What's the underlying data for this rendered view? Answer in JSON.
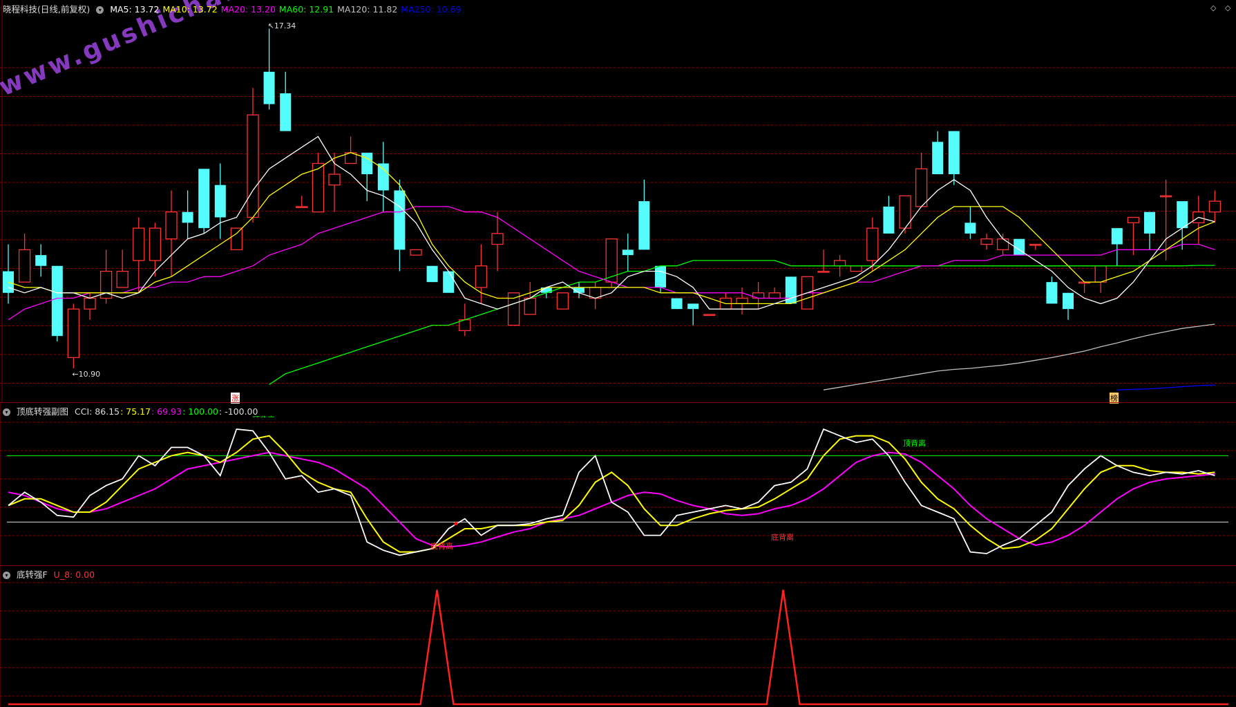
{
  "main": {
    "title": "晓程科技(日线,前复权)",
    "ma": [
      {
        "label": "MA5: 13.72",
        "color": "#ffffff"
      },
      {
        "label": "MA10: 13.72",
        "color": "#ffff00"
      },
      {
        "label": "MA20: 13.20",
        "color": "#ff00ff"
      },
      {
        "label": "MA60: 12.91",
        "color": "#00ff00"
      },
      {
        "label": "MA120: 11.82",
        "color": "#c0c0c0"
      },
      {
        "label": "MA250: 10.69",
        "color": "#0000ff"
      }
    ],
    "high_label": "17.34",
    "low_label": "10.90",
    "watermark": "www.gushichanghong.com",
    "badge_zhang": "涨",
    "badge_bang": "榜",
    "icon_left": "diamond-icon",
    "icon_right": "diamond-icon"
  },
  "sub": {
    "title": "顶底转强副图",
    "cci_label": "CCI: 86.15",
    "v1": ": 75.17",
    "v2": ": 69.93",
    "v3": ": 100.00",
    "v4": ": -100.00",
    "top_div_1": "顶背离",
    "top_div_2": "顶背离",
    "bottom_div_1": "底背离",
    "bottom_div_2": "底背离",
    "star": "★"
  },
  "bottom": {
    "title": "底转强F",
    "u8_label": "U_8: 0.00"
  },
  "colors": {
    "up": "#ff3232",
    "down": "#54fcfc",
    "grid": "#8b0000",
    "ma5": "#ffffff",
    "ma10": "#ffff00",
    "ma20": "#ff00ff",
    "ma60": "#00ff00",
    "ma120": "#c0c0c0",
    "ma250": "#0000ff"
  },
  "chart_data": [
    {
      "type": "candlestick",
      "y_range": [
        10.5,
        17.6
      ],
      "candles": [
        [
          12.8,
          12.4,
          13.3,
          12.2
        ],
        [
          12.6,
          13.2,
          13.5,
          12.6
        ],
        [
          13.1,
          12.9,
          13.3,
          12.7
        ],
        [
          12.9,
          11.6,
          12.9,
          11.5
        ],
        [
          11.2,
          12.1,
          12.2,
          11.0
        ],
        [
          12.1,
          12.3,
          12.4,
          11.9
        ],
        [
          12.3,
          12.8,
          13.2,
          12.2
        ],
        [
          12.5,
          12.8,
          13.2,
          12.7
        ],
        [
          13.0,
          13.6,
          13.8,
          12.4
        ],
        [
          13.0,
          13.6,
          13.7,
          12.7
        ],
        [
          13.4,
          13.9,
          14.3,
          12.7
        ],
        [
          13.9,
          13.7,
          14.3,
          13.4
        ],
        [
          14.7,
          13.6,
          14.6,
          13.5
        ],
        [
          14.4,
          13.8,
          14.8,
          13.4
        ],
        [
          13.2,
          13.6,
          13.6,
          13.2
        ],
        [
          13.8,
          15.7,
          16.2,
          13.7
        ],
        [
          16.5,
          15.9,
          17.3,
          15.8
        ],
        [
          16.1,
          15.4,
          16.5,
          15.4
        ],
        [
          14.0,
          14.0,
          14.2,
          14.0
        ],
        [
          13.9,
          14.8,
          15.0,
          13.9
        ],
        [
          14.4,
          14.6,
          15.0,
          13.9
        ],
        [
          14.8,
          15.0,
          15.3,
          14.8
        ],
        [
          15.0,
          14.6,
          14.9,
          14.1
        ],
        [
          14.8,
          14.3,
          15.2,
          13.9
        ],
        [
          14.3,
          13.2,
          14.5,
          12.8
        ],
        [
          13.1,
          13.2,
          13.2,
          13.1
        ],
        [
          12.9,
          12.6,
          12.9,
          12.6
        ],
        [
          12.8,
          12.4,
          12.8,
          12.5
        ],
        [
          11.7,
          11.9,
          12.2,
          11.6
        ],
        [
          12.5,
          12.9,
          13.3,
          12.2
        ],
        [
          13.3,
          13.5,
          13.9,
          12.8
        ],
        [
          11.8,
          12.4,
          12.4,
          11.8
        ],
        [
          12.0,
          12.3,
          12.6,
          12.0
        ],
        [
          12.5,
          12.4,
          12.5,
          12.3
        ],
        [
          12.1,
          12.4,
          12.4,
          12.1
        ],
        [
          12.5,
          12.4,
          12.6,
          12.3
        ],
        [
          12.3,
          12.5,
          12.6,
          12.1
        ],
        [
          12.6,
          13.4,
          13.4,
          12.5
        ],
        [
          13.2,
          13.1,
          13.5,
          12.8
        ],
        [
          14.1,
          13.2,
          14.5,
          13.2
        ],
        [
          12.9,
          12.5,
          12.9,
          12.4
        ],
        [
          12.3,
          12.1,
          12.3,
          12.1
        ],
        [
          12.2,
          12.1,
          12.2,
          11.8
        ],
        [
          12.0,
          12.0,
          12.0,
          12.0
        ],
        [
          12.1,
          12.3,
          12.4,
          12.1
        ],
        [
          12.2,
          12.3,
          12.5,
          12.0
        ],
        [
          12.3,
          12.4,
          12.6,
          12.1
        ],
        [
          12.3,
          12.4,
          12.5,
          12.3
        ],
        [
          12.7,
          12.2,
          12.7,
          12.2
        ],
        [
          12.1,
          12.7,
          12.7,
          12.1
        ],
        [
          12.8,
          12.8,
          13.2,
          12.8
        ],
        [
          12.9,
          13.0,
          13.1,
          12.7
        ],
        [
          12.8,
          12.9,
          12.9,
          12.8
        ],
        [
          13.0,
          13.6,
          13.8,
          12.8
        ],
        [
          14.0,
          13.5,
          14.2,
          13.5
        ],
        [
          13.6,
          14.2,
          14.2,
          13.5
        ],
        [
          14.0,
          14.7,
          15.0,
          14.0
        ],
        [
          15.2,
          14.6,
          15.4,
          14.6
        ],
        [
          15.4,
          14.6,
          15.0,
          14.4
        ],
        [
          13.7,
          13.5,
          14.0,
          13.4
        ],
        [
          13.3,
          13.4,
          13.5,
          13.2
        ],
        [
          13.2,
          13.4,
          13.5,
          13.1
        ],
        [
          13.4,
          13.1,
          13.4,
          13.1
        ],
        [
          13.3,
          13.3,
          13.3,
          13.2
        ],
        [
          12.6,
          12.2,
          12.7,
          12.2
        ],
        [
          12.4,
          12.1,
          12.4,
          11.9
        ],
        [
          12.6,
          12.6,
          12.6,
          12.4
        ],
        [
          12.6,
          12.9,
          12.9,
          12.4
        ],
        [
          13.6,
          13.3,
          13.6,
          12.9
        ],
        [
          13.7,
          13.8,
          13.8,
          13.1
        ],
        [
          13.9,
          13.5,
          13.9,
          13.2
        ],
        [
          14.2,
          14.2,
          14.5,
          13.0
        ],
        [
          14.1,
          13.6,
          14.1,
          13.2
        ],
        [
          13.7,
          13.9,
          14.2,
          13.3
        ],
        [
          13.9,
          14.1,
          14.3,
          13.7
        ]
      ],
      "series": {
        "ma5": [
          12.5,
          12.4,
          12.5,
          12.4,
          12.4,
          12.3,
          12.4,
          12.3,
          12.4,
          12.8,
          13.1,
          13.4,
          13.5,
          13.7,
          13.8,
          14.3,
          14.7,
          14.9,
          15.1,
          15.3,
          14.8,
          14.6,
          14.3,
          14.2,
          14.0,
          13.7,
          13.2,
          12.8,
          12.3,
          12.2,
          12.1,
          12.2,
          12.3,
          12.5,
          12.6,
          12.4,
          12.3,
          12.4,
          12.7,
          12.8,
          12.8,
          12.7,
          12.5,
          12.1,
          12.1,
          12.1,
          12.1,
          12.2,
          12.3,
          12.4,
          12.5,
          12.6,
          12.7,
          12.9,
          13.2,
          13.6,
          14.0,
          14.3,
          14.5,
          14.3,
          13.8,
          13.4,
          13.2,
          13.0,
          12.8,
          12.5,
          12.3,
          12.2,
          12.3,
          12.6,
          13.0,
          13.4,
          13.6,
          13.8,
          13.72
        ],
        "ma10": [
          12.6,
          12.5,
          12.5,
          12.4,
          12.4,
          12.4,
          12.4,
          12.4,
          12.4,
          12.6,
          12.7,
          12.9,
          13.1,
          13.3,
          13.5,
          13.8,
          14.2,
          14.4,
          14.6,
          14.7,
          14.9,
          15.0,
          14.9,
          14.7,
          14.4,
          13.9,
          13.3,
          12.9,
          12.6,
          12.4,
          12.3,
          12.3,
          12.4,
          12.5,
          12.5,
          12.5,
          12.5,
          12.5,
          12.5,
          12.5,
          12.4,
          12.4,
          12.4,
          12.3,
          12.2,
          12.2,
          12.2,
          12.2,
          12.2,
          12.3,
          12.4,
          12.5,
          12.6,
          12.8,
          13.0,
          13.2,
          13.5,
          13.8,
          14.0,
          14.0,
          14.0,
          14.0,
          13.8,
          13.5,
          13.2,
          12.9,
          12.6,
          12.6,
          12.7,
          12.8,
          13.0,
          13.2,
          13.4,
          13.6,
          13.72
        ],
        "ma20": [
          11.9,
          12.1,
          12.2,
          12.3,
          12.3,
          12.4,
          12.4,
          12.4,
          12.5,
          12.5,
          12.6,
          12.6,
          12.7,
          12.7,
          12.8,
          12.9,
          13.1,
          13.2,
          13.3,
          13.5,
          13.6,
          13.7,
          13.8,
          13.9,
          13.9,
          14.0,
          14.0,
          14.0,
          13.9,
          13.9,
          13.8,
          13.6,
          13.4,
          13.2,
          13.0,
          12.8,
          12.7,
          12.6,
          12.5,
          12.5,
          12.5,
          12.4,
          12.4,
          12.4,
          12.4,
          12.4,
          12.3,
          12.3,
          12.3,
          12.4,
          12.4,
          12.5,
          12.6,
          12.6,
          12.7,
          12.8,
          12.9,
          12.9,
          13.0,
          13.0,
          13.0,
          13.1,
          13.1,
          13.1,
          13.1,
          13.1,
          13.1,
          13.1,
          13.2,
          13.2,
          13.2,
          13.2,
          13.3,
          13.3,
          13.2
        ],
        "ma60": [
          null,
          null,
          null,
          null,
          null,
          null,
          null,
          null,
          null,
          null,
          null,
          null,
          null,
          null,
          null,
          null,
          10.7,
          10.9,
          11.0,
          11.1,
          11.2,
          11.3,
          11.4,
          11.5,
          11.6,
          11.7,
          11.8,
          11.8,
          11.9,
          12.0,
          12.1,
          12.2,
          12.3,
          12.4,
          12.5,
          12.6,
          12.6,
          12.7,
          12.8,
          12.8,
          12.9,
          12.9,
          13.0,
          13.0,
          13.0,
          13.0,
          13.0,
          13.0,
          12.9,
          12.9,
          12.9,
          12.9,
          12.9,
          12.9,
          12.9,
          12.9,
          12.9,
          12.9,
          12.9,
          12.9,
          12.9,
          12.9,
          12.9,
          12.9,
          12.9,
          12.9,
          12.9,
          12.9,
          12.9,
          12.9,
          12.9,
          12.9,
          12.9,
          12.91,
          12.91
        ],
        "ma120": [
          null,
          null,
          null,
          null,
          null,
          null,
          null,
          null,
          null,
          null,
          null,
          null,
          null,
          null,
          null,
          null,
          null,
          null,
          null,
          null,
          null,
          null,
          null,
          null,
          null,
          null,
          null,
          null,
          null,
          null,
          null,
          null,
          null,
          null,
          null,
          null,
          null,
          null,
          null,
          null,
          null,
          null,
          null,
          null,
          null,
          null,
          null,
          null,
          null,
          null,
          10.6,
          10.65,
          10.7,
          10.75,
          10.8,
          10.85,
          10.9,
          10.95,
          10.98,
          11.0,
          11.03,
          11.06,
          11.1,
          11.15,
          11.2,
          11.26,
          11.32,
          11.4,
          11.47,
          11.55,
          11.62,
          11.68,
          11.74,
          11.78,
          11.82
        ],
        "ma250": [
          null,
          null,
          null,
          null,
          null,
          null,
          null,
          null,
          null,
          null,
          null,
          null,
          null,
          null,
          null,
          null,
          null,
          null,
          null,
          null,
          null,
          null,
          null,
          null,
          null,
          null,
          null,
          null,
          null,
          null,
          null,
          null,
          null,
          null,
          null,
          null,
          null,
          null,
          null,
          null,
          null,
          null,
          null,
          null,
          null,
          null,
          null,
          null,
          null,
          null,
          null,
          null,
          null,
          null,
          null,
          null,
          null,
          null,
          null,
          null,
          null,
          null,
          null,
          null,
          null,
          null,
          null,
          null,
          10.6,
          10.61,
          10.62,
          10.64,
          10.66,
          10.68,
          10.69
        ]
      }
    },
    {
      "type": "line",
      "y_range": [
        -220,
        230
      ],
      "reference_lines": [
        100,
        -100
      ],
      "series": {
        "cci": [
          -50,
          -10,
          -40,
          -80,
          -85,
          -20,
          10,
          30,
          100,
          70,
          125,
          125,
          100,
          40,
          180,
          175,
          110,
          30,
          40,
          -10,
          0,
          -20,
          -160,
          -185,
          -200,
          -190,
          -180,
          -120,
          -90,
          -140,
          -110,
          -110,
          -105,
          -90,
          -80,
          50,
          100,
          -40,
          -70,
          -140,
          -140,
          -80,
          -70,
          -60,
          -50,
          -60,
          -40,
          10,
          20,
          60,
          180,
          160,
          140,
          150,
          100,
          20,
          -50,
          -70,
          -90,
          -190,
          -195,
          -170,
          -150,
          -110,
          -70,
          10,
          60,
          100,
          70,
          50,
          40,
          50,
          45,
          55,
          40
        ],
        "ma_yellow": [
          -50,
          -30,
          -30,
          -50,
          -70,
          -70,
          -40,
          10,
          60,
          80,
          100,
          110,
          100,
          80,
          110,
          150,
          160,
          110,
          50,
          20,
          0,
          -10,
          -90,
          -160,
          -190,
          -190,
          -180,
          -150,
          -120,
          -120,
          -110,
          -110,
          -110,
          -100,
          -95,
          -50,
          20,
          50,
          10,
          -60,
          -110,
          -110,
          -90,
          -75,
          -65,
          -60,
          -55,
          -30,
          0,
          30,
          100,
          150,
          160,
          160,
          140,
          90,
          20,
          -30,
          -60,
          -110,
          -150,
          -180,
          -175,
          -155,
          -120,
          -60,
          0,
          50,
          70,
          70,
          55,
          50,
          50,
          45,
          50
        ],
        "ma_magenta": [
          -10,
          -20,
          -40,
          -60,
          -70,
          -70,
          -60,
          -40,
          -20,
          0,
          30,
          60,
          70,
          80,
          90,
          100,
          110,
          100,
          90,
          80,
          60,
          30,
          0,
          -50,
          -100,
          -150,
          -170,
          -175,
          -170,
          -160,
          -145,
          -130,
          -120,
          -100,
          -90,
          -80,
          -60,
          -40,
          -20,
          -10,
          -15,
          -35,
          -50,
          -60,
          -75,
          -80,
          -75,
          -60,
          -50,
          -30,
          0,
          40,
          80,
          100,
          110,
          105,
          80,
          40,
          0,
          -50,
          -90,
          -120,
          -150,
          -170,
          -160,
          -140,
          -110,
          -70,
          -30,
          0,
          20,
          30,
          35,
          40,
          45
        ]
      },
      "signals": [
        {
          "index": 28,
          "label": "★"
        }
      ]
    },
    {
      "type": "line",
      "y_range": [
        0,
        1.1
      ],
      "series": {
        "u8": [
          0,
          0,
          0,
          0,
          0,
          0,
          0,
          0,
          0,
          0,
          0,
          0,
          0,
          0,
          0,
          0,
          0,
          0,
          0,
          0,
          0,
          0,
          0,
          0,
          0,
          0,
          1,
          0,
          0,
          0,
          0,
          0,
          0,
          0,
          0,
          0,
          0,
          0,
          0,
          0,
          0,
          0,
          0,
          0,
          0,
          0,
          0,
          1,
          0,
          0,
          0,
          0,
          0,
          0,
          0,
          0,
          0,
          0,
          0,
          0,
          0,
          0,
          0,
          0,
          0,
          0,
          0,
          0,
          0,
          0,
          0,
          0,
          0,
          0,
          0
        ]
      }
    }
  ]
}
